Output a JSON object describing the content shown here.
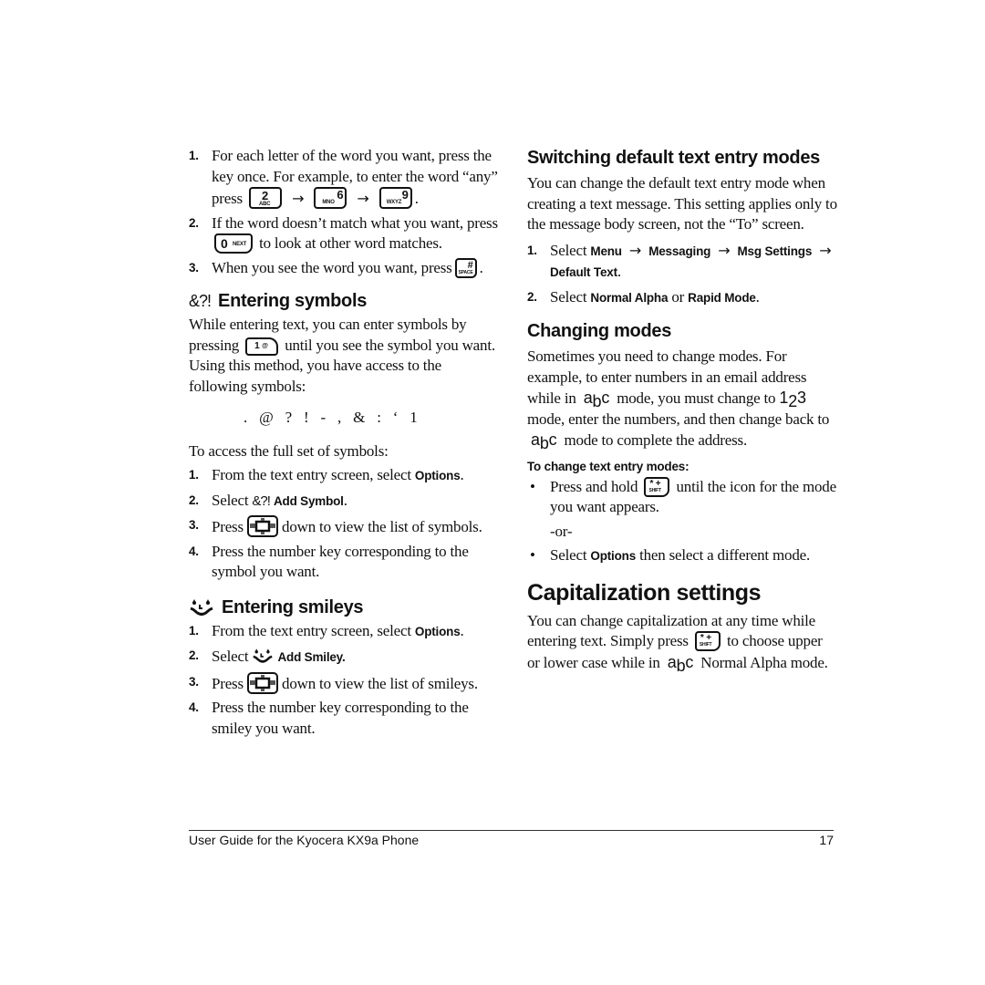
{
  "left": {
    "intro_steps": [
      {
        "num": "1.",
        "text_a": "For each letter of the word you want, press the key once. For example, to enter the word “any” press",
        "keys": [
          {
            "big": "2",
            "small": "ABC"
          },
          {
            "big": "6",
            "small": "MNO"
          },
          {
            "big": "9",
            "small": "WXYZ"
          }
        ],
        "arrow": "→",
        "end": "."
      },
      {
        "num": "2.",
        "text_a": "If the word doesn’t match what you want, press",
        "key": {
          "big": "0",
          "small": "NEXT"
        },
        "text_b": "to look at other word matches."
      },
      {
        "num": "3.",
        "text_a": "When you see the word you want, press",
        "key": {
          "big": "#",
          "small": "SPACE"
        },
        "text_b": "."
      }
    ],
    "symbols_section": {
      "icon": "&?!",
      "heading": "Entering symbols",
      "para_a": "While entering text, you can enter symbols by pressing",
      "key": {
        "big": "1",
        "small": "@"
      },
      "para_b": "until you see the symbol you want. Using this method, you have access to the following symbols:",
      "symbols": ". @ ? ! - , & : ‘ 1",
      "access_text": "To access the full set of symbols:",
      "steps": [
        {
          "num": "1.",
          "text_a": "From the text entry screen, select",
          "bold": "Options",
          "text_b": "."
        },
        {
          "num": "2.",
          "text_a": "Select",
          "icon": "&?!",
          "bold": "Add Symbol",
          "text_b": "."
        },
        {
          "num": "3.",
          "text_a": "Press",
          "text_b": "down to view the list of symbols."
        },
        {
          "num": "4.",
          "text_a": "Press the number key corresponding to the symbol you want."
        }
      ]
    },
    "smileys_section": {
      "heading": "Entering smileys",
      "steps": [
        {
          "num": "1.",
          "text_a": "From the text entry screen, select",
          "bold": "Options",
          "text_b": "."
        },
        {
          "num": "2.",
          "text_a": "Select",
          "bold": "Add Smiley."
        },
        {
          "num": "3.",
          "text_a": "Press",
          "text_b": "down to view the list of smileys."
        },
        {
          "num": "4.",
          "text_a": "Press the number key corresponding to the smiley you want."
        }
      ]
    }
  },
  "right": {
    "switching": {
      "heading": "Switching default text entry modes",
      "para": "You can change the default text entry mode when creating a text message. This setting applies only to the message body screen, not the “To” screen.",
      "step1": {
        "num": "1.",
        "select": "Select",
        "path": [
          "Menu",
          "Messaging",
          "Msg Settings",
          "Default Text"
        ],
        "arrow": "→",
        "end": "."
      },
      "step2": {
        "num": "2.",
        "select": "Select",
        "opt1": "Normal Alpha",
        "or": "or",
        "opt2": "Rapid Mode",
        "end": "."
      }
    },
    "changing": {
      "heading": "Changing modes",
      "para_a": "Sometimes you need to change modes. For example, to enter numbers in an email address while in",
      "abc_icon": {
        "a": "a",
        "b": "b",
        "c": "c"
      },
      "para_b": "mode, you must change to",
      "num_icon": {
        "a": "1",
        "b": "2",
        "c": "3"
      },
      "para_c": "mode, enter the numbers, and then change back to",
      "para_d": "mode to complete the address.",
      "subheading": "To change text entry modes:",
      "bullet1_a": "Press and hold",
      "shift_key": {
        "big": "* +",
        "small": "SHIFT"
      },
      "bullet1_b": "until the icon for the mode you want appears.",
      "or_text": "-or-",
      "bullet2_a": "Select",
      "bullet2_bold": "Options",
      "bullet2_b": "then select a different mode.",
      "bullet": "•"
    },
    "capitalization": {
      "heading": "Capitalization settings",
      "para_a": "You can change capitalization at any time while entering text. Simply press",
      "para_b": "to choose upper or lower case while in",
      "para_c": "Normal Alpha mode."
    }
  },
  "footer": {
    "title": "User Guide for the Kyocera KX9a Phone",
    "page": "17"
  }
}
